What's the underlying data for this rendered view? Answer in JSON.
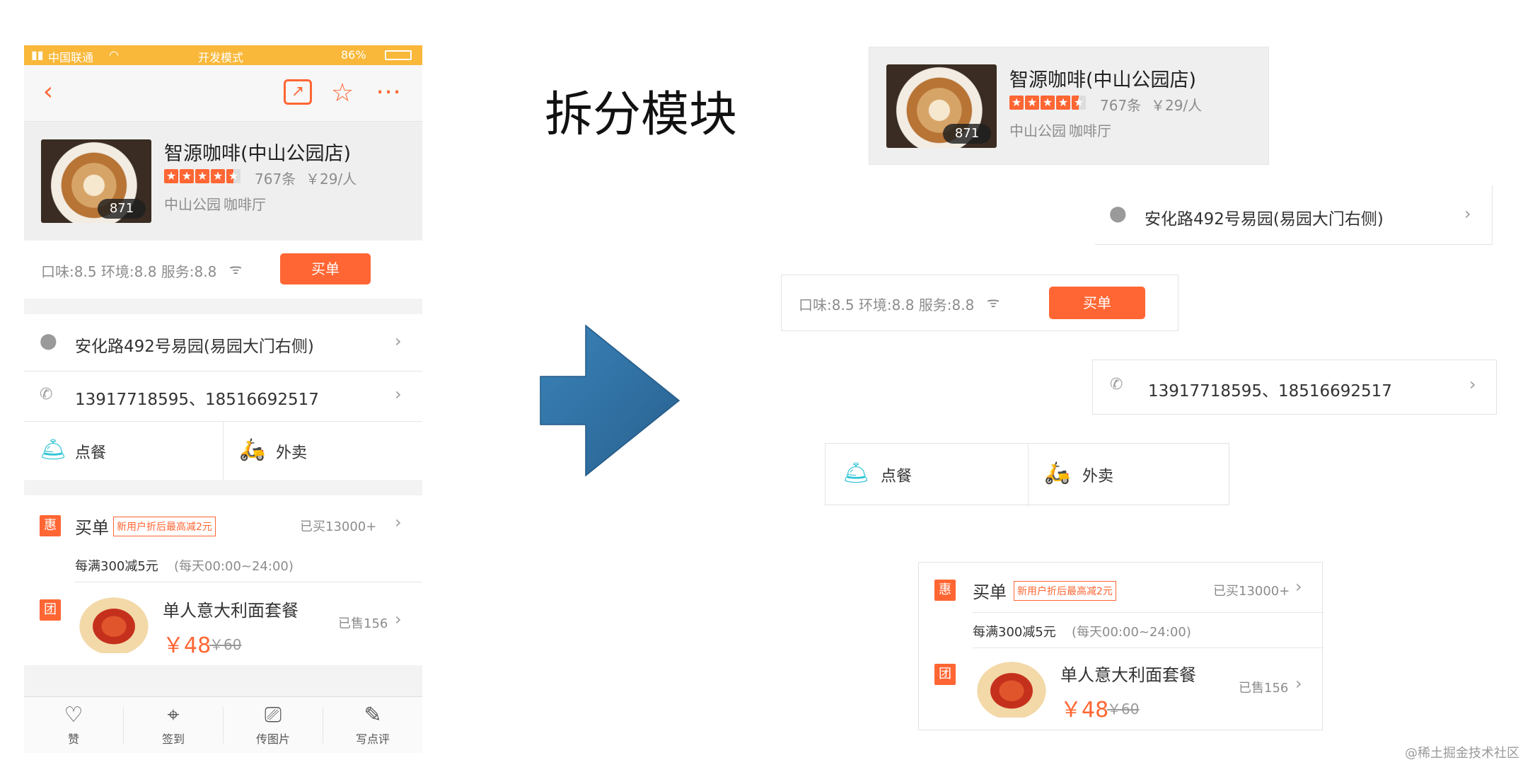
{
  "status_bar": {
    "carrier": "中国联通",
    "mode": "开发模式",
    "battery": "86%"
  },
  "nav": {
    "back_icon": "back-chevron-icon",
    "share_icon": "share-icon",
    "star_icon": "star-icon",
    "more_icon": "more-icon"
  },
  "shop": {
    "name": "智源咖啡(中山公园店)",
    "photo_count": "871",
    "review_count": "767条",
    "price_per_person": "￥29/人",
    "area": "中山公园",
    "category": "咖啡厅",
    "rating": 4.5
  },
  "scores": {
    "text": "口味:8.5 环境:8.8 服务:8.8",
    "pay_button": "买单"
  },
  "address": {
    "text": "安化路492号易园(易园大门右侧)"
  },
  "phone": {
    "text": "13917718595、18516692517"
  },
  "services": {
    "dine": "点餐",
    "takeaway": "外卖"
  },
  "deal": {
    "badge": "惠",
    "title": "买单",
    "tag": "新用户折后最高减2元",
    "bought": "已买13000+",
    "rule": "每满300减5元",
    "hours": "(每天00:00~24:00)"
  },
  "group": {
    "badge": "团",
    "title": "单人意大利面套餐",
    "price": "￥48",
    "original_price": "￥60",
    "sold": "已售156"
  },
  "tabbar": {
    "like": "赞",
    "checkin": "签到",
    "photo": "传图片",
    "review": "写点评"
  },
  "heading": "拆分模块",
  "watermark": "@稀土掘金技术社区",
  "colors": {
    "accent": "#ff6633",
    "status_bar": "#f9b83a",
    "arrow": "#2f6fa0",
    "dine_icon": "#2ec4d6",
    "takeaway_icon": "#22b573"
  }
}
